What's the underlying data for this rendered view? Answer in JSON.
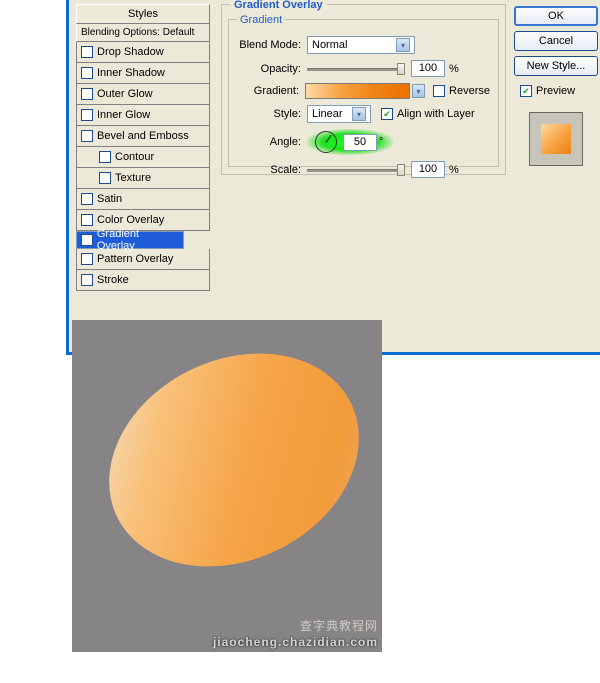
{
  "styles_header": "Styles",
  "styles_sub": "Blending Options: Default",
  "styles": [
    {
      "label": "Drop Shadow",
      "checked": false
    },
    {
      "label": "Inner Shadow",
      "checked": false
    },
    {
      "label": "Outer Glow",
      "checked": false
    },
    {
      "label": "Inner Glow",
      "checked": false
    },
    {
      "label": "Bevel and Emboss",
      "checked": false
    },
    {
      "label": "Contour",
      "checked": false,
      "sub": true
    },
    {
      "label": "Texture",
      "checked": false,
      "sub": true
    },
    {
      "label": "Satin",
      "checked": false
    },
    {
      "label": "Color Overlay",
      "checked": false
    },
    {
      "label": "Gradient Overlay",
      "checked": true,
      "selected": true
    },
    {
      "label": "Pattern Overlay",
      "checked": false
    },
    {
      "label": "Stroke",
      "checked": false
    }
  ],
  "panel": {
    "title": "Gradient Overlay",
    "group": "Gradient",
    "blend_label": "Blend Mode:",
    "blend_value": "Normal",
    "opacity_label": "Opacity:",
    "opacity_value": "100",
    "pct": "%",
    "gradient_label": "Gradient:",
    "reverse_label": "Reverse",
    "reverse_checked": false,
    "style_label": "Style:",
    "style_value": "Linear",
    "align_label": "Align with Layer",
    "align_checked": true,
    "angle_label": "Angle:",
    "angle_value": "50",
    "deg": "°",
    "scale_label": "Scale:",
    "scale_value": "100"
  },
  "buttons": {
    "ok": "OK",
    "cancel": "Cancel",
    "newstyle": "New Style...",
    "preview": "Preview"
  },
  "watermark1": "查字典教程网",
  "watermark2": "jiaocheng.chazidian.com"
}
